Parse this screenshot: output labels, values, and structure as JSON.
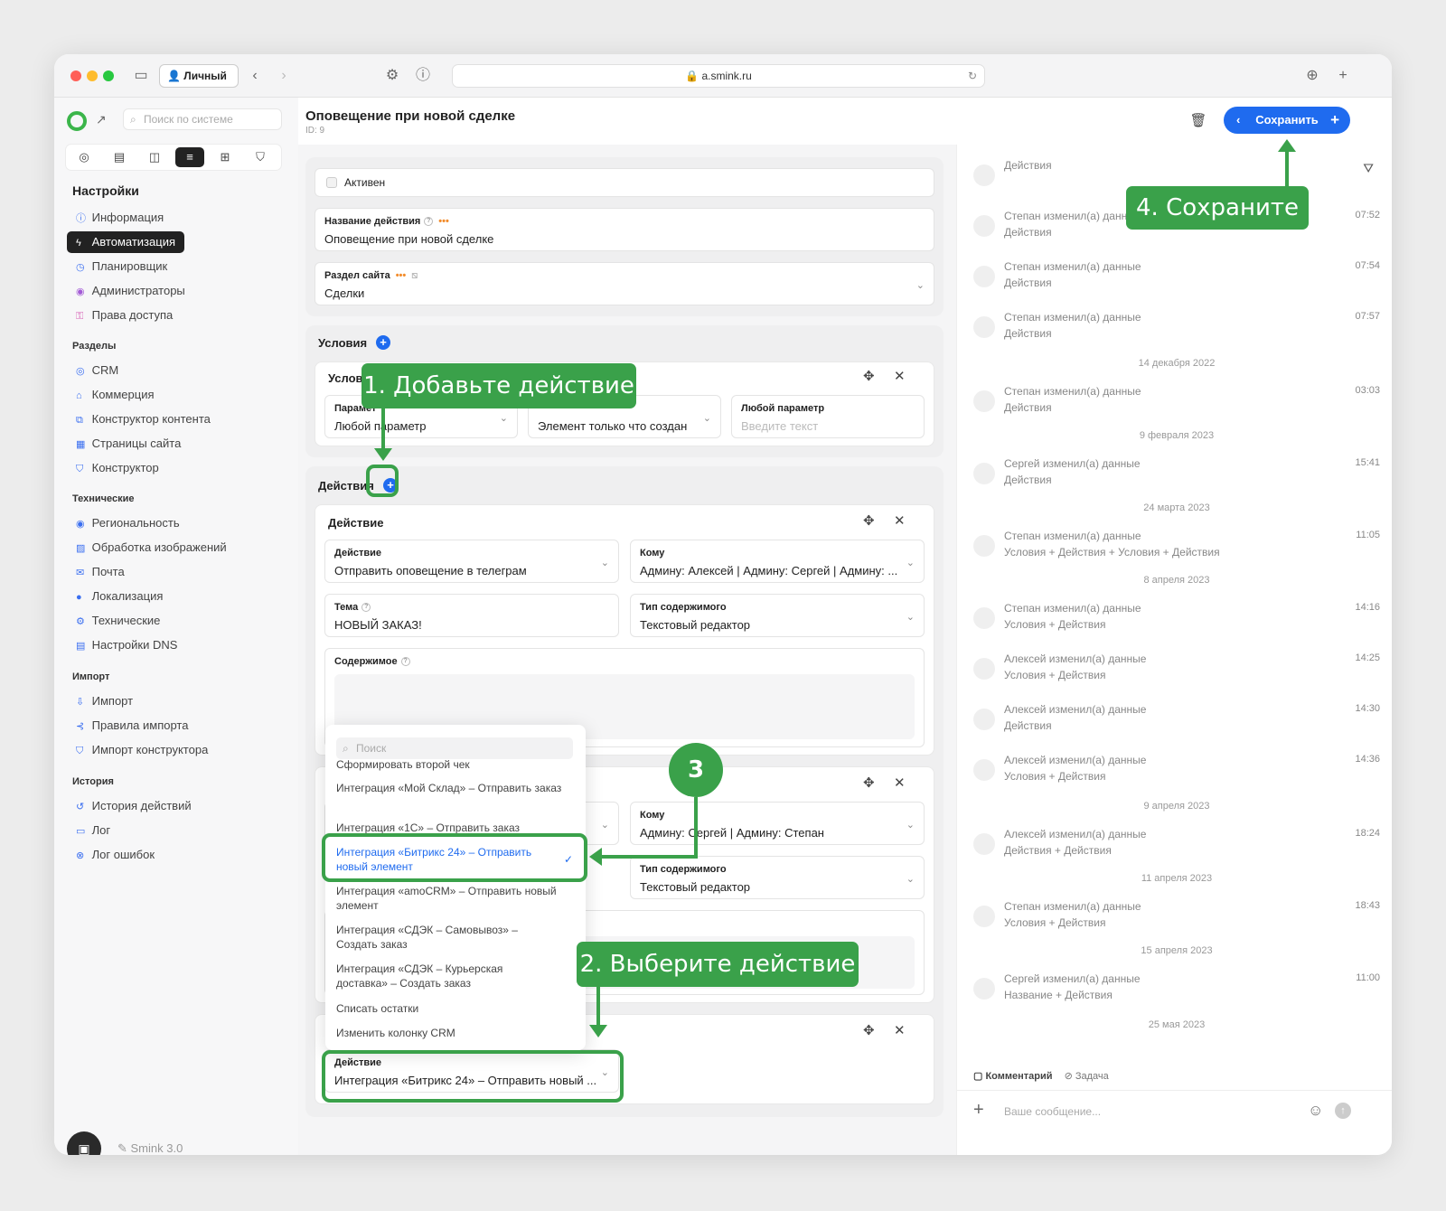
{
  "titlebar": {
    "profile": "Личный",
    "url": "a.smink.ru"
  },
  "sidebar": {
    "search_placeholder": "Поиск по системе",
    "heading": "Настройки",
    "settings_items": [
      {
        "label": "Информация",
        "icon": "info-icon"
      },
      {
        "label": "Автоматизация",
        "icon": "bolt-icon",
        "active": true
      },
      {
        "label": "Планировщик",
        "icon": "clock-icon"
      },
      {
        "label": "Администраторы",
        "icon": "user-icon"
      },
      {
        "label": "Права доступа",
        "icon": "key-icon"
      }
    ],
    "groups": [
      {
        "title": "Разделы",
        "items": [
          "CRM",
          "Коммерция",
          "Конструктор контента",
          "Страницы сайта",
          "Конструктор"
        ]
      },
      {
        "title": "Технические",
        "items": [
          "Региональность",
          "Обработка изображений",
          "Почта",
          "Локализация",
          "Технические",
          "Настройки DNS"
        ]
      },
      {
        "title": "Импорт",
        "items": [
          "Импорт",
          "Правила импорта",
          "Импорт конструктора"
        ]
      },
      {
        "title": "История",
        "items": [
          "История действий",
          "Лог",
          "Лог ошибок"
        ]
      }
    ],
    "version": "Smink 3.0"
  },
  "header": {
    "title": "Оповещение при новой сделке",
    "id": "ID: 9",
    "save_label": "Сохранить"
  },
  "form": {
    "active_label": "Активен",
    "name_label": "Название действия",
    "name_value": "Оповещение при новой сделке",
    "section_label": "Раздел сайта",
    "section_value": "Сделки"
  },
  "conditions": {
    "title": "Условия",
    "card_title": "Услов",
    "param_label": "Парамет",
    "param_value": "Любой параметр",
    "event_value": "Элемент только что создан",
    "any_param_label": "Любой параметр",
    "any_param_placeholder": "Введите текст"
  },
  "actions": {
    "title": "Действия",
    "card1": {
      "title": "Действие",
      "action_label": "Действие",
      "action_value": "Отправить оповещение в телеграм",
      "to_label": "Кому",
      "to_value": "Админу: Алексей | Админу: Сергей | Админу: ...",
      "subject_label": "Тема",
      "subject_value": "НОВЫЙ ЗАКАЗ!",
      "ctype_label": "Тип содержимого",
      "ctype_value": "Текстовый редактор",
      "content_label": "Содержимое"
    },
    "card2": {
      "to_label": "Кому",
      "to_value": "Админу: Сергей | Админу: Степан",
      "ctype_label": "Тип содержимого",
      "ctype_value": "Текстовый редактор"
    },
    "card3": {
      "action_label": "Действие",
      "action_value": "Интеграция «Битрикс 24» – Отправить новый ..."
    }
  },
  "dropdown": {
    "search_placeholder": "Поиск",
    "items": [
      "Сформировать второй чек",
      "Интеграция «Мой Склад» – Отправить заказ",
      "Интеграция «1С» – Отправить заказ",
      "Интеграция «Битрикс 24» – Отправить новый элемент",
      "Интеграция «amoCRM» – Отправить новый элемент",
      "Интеграция «СДЭК – Самовывоз» – Создать заказ",
      "Интеграция «СДЭК – Курьерская доставка» – Создать заказ",
      "Списать остатки",
      "Изменить колонку CRM"
    ]
  },
  "log": {
    "entries": [
      {
        "title": "",
        "sub": "Действия",
        "time": ""
      },
      {
        "title": "Степан изменил(а) данные",
        "sub": "Действия",
        "time": "07:52"
      },
      {
        "title": "Степан изменил(а) данные",
        "sub": "Действия",
        "time": "07:54"
      },
      {
        "title": "Степан изменил(а) данные",
        "sub": "Действия",
        "time": "07:57"
      },
      {
        "date": "14 декабря 2022"
      },
      {
        "title": "Степан изменил(а) данные",
        "sub": "Действия",
        "time": "03:03"
      },
      {
        "date": "9 февраля 2023"
      },
      {
        "title": "Сергей изменил(а) данные",
        "sub": "Действия",
        "time": "15:41"
      },
      {
        "date": "24 марта 2023"
      },
      {
        "title": "Степан изменил(а) данные",
        "sub": "Условия + Действия + Условия + Действия",
        "time": "11:05"
      },
      {
        "date": "8 апреля 2023"
      },
      {
        "title": "Степан изменил(а) данные",
        "sub": "Условия + Действия",
        "time": "14:16"
      },
      {
        "title": "Алексей изменил(а) данные",
        "sub": "Условия + Действия",
        "time": "14:25"
      },
      {
        "title": "Алексей изменил(а) данные",
        "sub": "Действия",
        "time": "14:30"
      },
      {
        "title": "Алексей изменил(а) данные",
        "sub": "Условия + Действия",
        "time": "14:36"
      },
      {
        "date": "9 апреля 2023"
      },
      {
        "title": "Алексей изменил(а) данные",
        "sub": "Действия + Действия",
        "time": "18:24"
      },
      {
        "date": "11 апреля 2023"
      },
      {
        "title": "Степан изменил(а) данные",
        "sub": "Условия + Действия",
        "time": "18:43"
      },
      {
        "date": "15 апреля 2023"
      },
      {
        "title": "Сергей изменил(а) данные",
        "sub": "Название + Действия",
        "time": "11:00"
      },
      {
        "date": "25 мая 2023"
      }
    ],
    "tab_comment": "Комментарий",
    "tab_task": "Задача",
    "message_placeholder": "Ваше сообщение..."
  },
  "callouts": {
    "step1": "1. Добавьте действие",
    "step2": "2. Выберите действие",
    "step3": "3",
    "step4": "4. Сохраните"
  },
  "colors": {
    "accent": "#1f6bef",
    "callout_green": "#3aa14a",
    "dark": "#222222"
  }
}
